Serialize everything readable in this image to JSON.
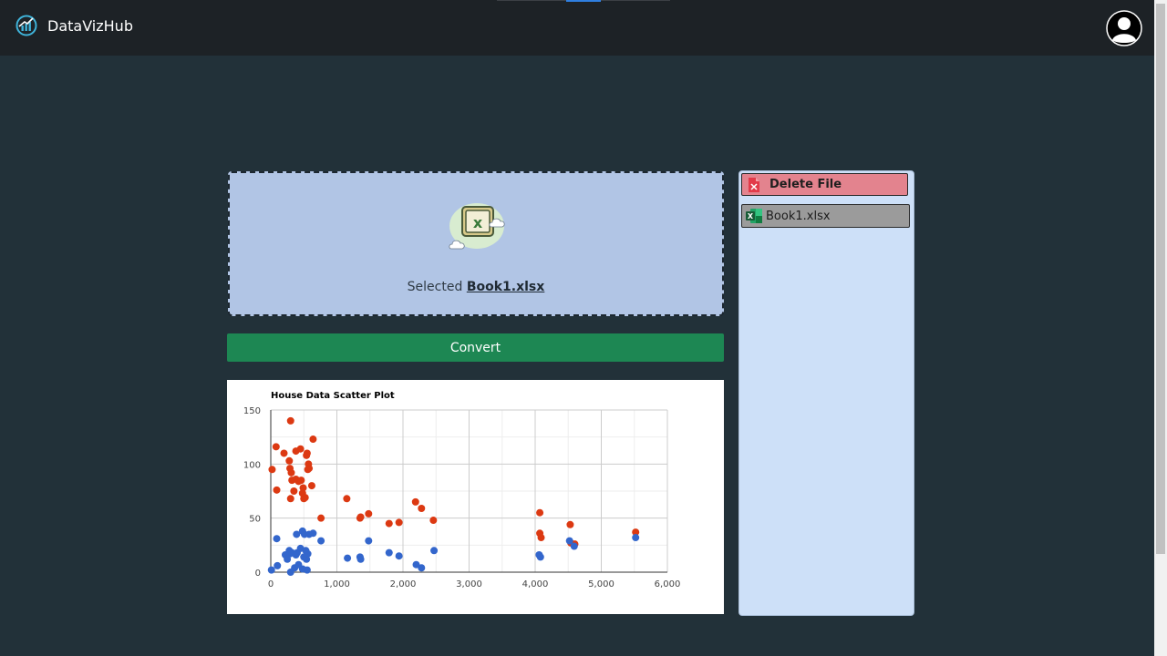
{
  "app": {
    "name": "DataVizHub"
  },
  "upload": {
    "selected_prefix": "Selected",
    "selected_file": "Book1.xlsx"
  },
  "actions": {
    "convert_label": "Convert"
  },
  "sidebar": {
    "delete_label": "Delete File",
    "files": [
      "Book1.xlsx"
    ]
  },
  "icons": {
    "logo": "chart-logo-icon",
    "avatar": "user-avatar-icon",
    "file_upload": "excel-file-icon",
    "delete": "file-delete-icon",
    "excel": "excel-icon"
  },
  "colors": {
    "series_red": "#dc3912",
    "series_blue": "#3366cc",
    "convert": "#1d8753",
    "delete": "#e3838e",
    "panel": "#cde0f8",
    "dropzone": "#b1c5e5"
  },
  "chart_data": {
    "type": "scatter",
    "title": "House Data Scatter Plot",
    "xlim": [
      0,
      6000
    ],
    "ylim": [
      0,
      150
    ],
    "x_ticks": [
      "0",
      "1,000",
      "2,000",
      "3,000",
      "4,000",
      "5,000",
      "6,000"
    ],
    "y_ticks": [
      "0",
      "50",
      "100",
      "150"
    ],
    "grid": true,
    "legend": "none",
    "series": [
      {
        "color": "#dc3912",
        "points": [
          [
            20,
            95
          ],
          [
            80,
            116
          ],
          [
            90,
            76
          ],
          [
            200,
            110
          ],
          [
            280,
            103
          ],
          [
            290,
            96
          ],
          [
            300,
            68
          ],
          [
            300,
            140
          ],
          [
            310,
            92
          ],
          [
            320,
            85
          ],
          [
            350,
            75
          ],
          [
            380,
            112
          ],
          [
            380,
            86
          ],
          [
            420,
            84
          ],
          [
            450,
            114
          ],
          [
            460,
            85
          ],
          [
            480,
            73
          ],
          [
            490,
            78
          ],
          [
            500,
            68
          ],
          [
            520,
            69
          ],
          [
            540,
            108
          ],
          [
            550,
            110
          ],
          [
            570,
            100
          ],
          [
            560,
            95
          ],
          [
            580,
            96
          ],
          [
            620,
            80
          ],
          [
            640,
            123
          ],
          [
            760,
            50
          ],
          [
            1150,
            68
          ],
          [
            1350,
            50
          ],
          [
            1360,
            51
          ],
          [
            1480,
            54
          ],
          [
            1790,
            45
          ],
          [
            1940,
            46
          ],
          [
            2190,
            65
          ],
          [
            2280,
            59
          ],
          [
            2460,
            48
          ],
          [
            4070,
            55
          ],
          [
            4070,
            36
          ],
          [
            4090,
            32
          ],
          [
            4530,
            44
          ],
          [
            4540,
            27
          ],
          [
            4600,
            26
          ],
          [
            5520,
            37
          ]
        ]
      },
      {
        "color": "#3366cc",
        "points": [
          [
            10,
            2
          ],
          [
            90,
            31
          ],
          [
            100,
            6
          ],
          [
            220,
            16
          ],
          [
            250,
            12
          ],
          [
            280,
            20
          ],
          [
            290,
            17
          ],
          [
            300,
            0
          ],
          [
            320,
            18
          ],
          [
            360,
            4
          ],
          [
            380,
            16
          ],
          [
            390,
            35
          ],
          [
            400,
            18
          ],
          [
            420,
            7
          ],
          [
            450,
            22
          ],
          [
            480,
            38
          ],
          [
            480,
            3
          ],
          [
            500,
            14
          ],
          [
            510,
            35
          ],
          [
            530,
            20
          ],
          [
            540,
            12
          ],
          [
            550,
            2
          ],
          [
            560,
            17
          ],
          [
            580,
            35
          ],
          [
            640,
            36
          ],
          [
            760,
            29
          ],
          [
            1160,
            13
          ],
          [
            1350,
            14
          ],
          [
            1360,
            12
          ],
          [
            1480,
            29
          ],
          [
            1790,
            18
          ],
          [
            1940,
            15
          ],
          [
            2200,
            7
          ],
          [
            2280,
            4
          ],
          [
            2470,
            20
          ],
          [
            4060,
            16
          ],
          [
            4080,
            14
          ],
          [
            4520,
            29
          ],
          [
            4590,
            24
          ],
          [
            5520,
            32
          ]
        ]
      }
    ]
  }
}
